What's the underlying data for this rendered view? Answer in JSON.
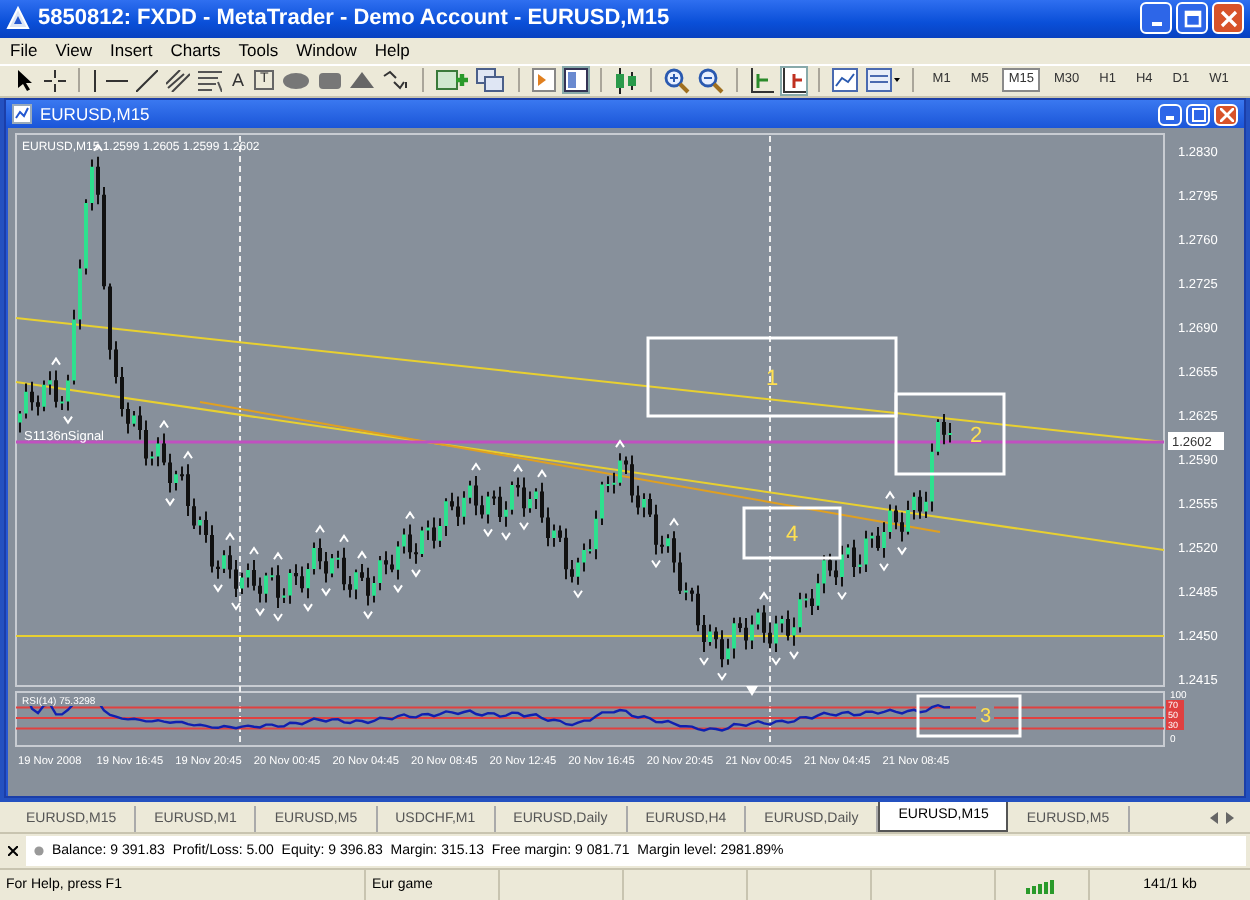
{
  "window": {
    "title": "5850812: FXDD - MetaTrader - Demo Account - EURUSD,M15"
  },
  "menu": [
    "File",
    "View",
    "Insert",
    "Charts",
    "Tools",
    "Window",
    "Help"
  ],
  "toolbar": {
    "text_tool": "A",
    "label_tool": "T"
  },
  "timeframes": [
    {
      "label": "M1",
      "selected": false
    },
    {
      "label": "M5",
      "selected": false
    },
    {
      "label": "M15",
      "selected": true
    },
    {
      "label": "M30",
      "selected": false
    },
    {
      "label": "H1",
      "selected": false
    },
    {
      "label": "H4",
      "selected": false
    },
    {
      "label": "D1",
      "selected": false
    },
    {
      "label": "W1",
      "selected": false
    }
  ],
  "chart_window": {
    "title": "EURUSD,M15"
  },
  "chart": {
    "header": "EURUSD,M15  1.2599 1.2605 1.2599 1.2602",
    "signal_label": "S1136nSignal",
    "price_labels": [
      "1.2830",
      "1.2795",
      "1.2760",
      "1.2725",
      "1.2690",
      "1.2655",
      "1.2625",
      "1.2590",
      "1.2555",
      "1.2520",
      "1.2485",
      "1.2450",
      "1.2415"
    ],
    "current_price": "1.2602",
    "boxes": [
      {
        "label": "1"
      },
      {
        "label": "2"
      },
      {
        "label": "4"
      }
    ],
    "rsi": {
      "header": "RSI(14) 75.3298",
      "box": {
        "label": "3"
      },
      "scale": [
        {
          "text": "100",
          "kind": "plain"
        },
        {
          "text": "70",
          "kind": "level"
        },
        {
          "text": "50",
          "kind": "level"
        },
        {
          "text": "30",
          "kind": "level"
        },
        {
          "text": "0",
          "kind": "plain"
        }
      ]
    },
    "time_labels": [
      "19 Nov 2008",
      "19 Nov 16:45",
      "19 Nov 20:45",
      "20 Nov 00:45",
      "20 Nov 04:45",
      "20 Nov 08:45",
      "20 Nov 12:45",
      "20 Nov 16:45",
      "20 Nov 20:45",
      "21 Nov 00:45",
      "21 Nov 04:45",
      "21 Nov 08:45"
    ]
  },
  "tabs": [
    {
      "label": "EURUSD,M15",
      "selected": false
    },
    {
      "label": "EURUSD,M1",
      "selected": false
    },
    {
      "label": "EURUSD,M5",
      "selected": false
    },
    {
      "label": "USDCHF,M1",
      "selected": false
    },
    {
      "label": "EURUSD,Daily",
      "selected": false
    },
    {
      "label": "EURUSD,H4",
      "selected": false
    },
    {
      "label": "EURUSD,Daily",
      "selected": false
    },
    {
      "label": "EURUSD,M15",
      "selected": true
    },
    {
      "label": "EURUSD,M5",
      "selected": false
    }
  ],
  "terminal": {
    "summary": "Balance: 9 391.83  Profit/Loss: 5.00  Equity: 9 396.83  Margin: 315.13  Free margin: 9 081.71  Margin level: 2981.89%"
  },
  "status_bar": {
    "help": "For Help, press F1",
    "profile": "Eur game",
    "traffic": "141/1 kb"
  }
}
